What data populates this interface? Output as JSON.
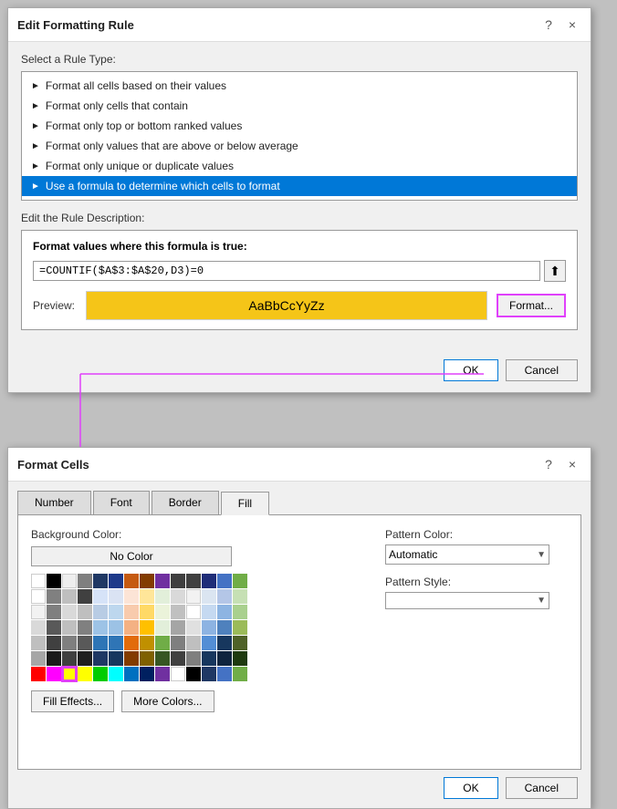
{
  "edit_dialog": {
    "title": "Edit Formatting Rule",
    "help_icon": "?",
    "close_icon": "×",
    "select_rule_label": "Select a Rule Type:",
    "rules": [
      {
        "label": "Format all cells based on their values",
        "selected": false
      },
      {
        "label": "Format only cells that contain",
        "selected": false
      },
      {
        "label": "Format only top or bottom ranked values",
        "selected": false
      },
      {
        "label": "Format only values that are above or below average",
        "selected": false
      },
      {
        "label": "Format only unique or duplicate values",
        "selected": false
      },
      {
        "label": "Use a formula to determine which cells to format",
        "selected": true
      }
    ],
    "desc_label": "Edit the Rule Description:",
    "desc_title": "Format values where this formula is true:",
    "formula_value": "=COUNTIF($A$3:$A$20,D3)=0",
    "preview_label": "Preview:",
    "preview_text": "AaBbCcYyZz",
    "format_btn_label": "Format...",
    "ok_label": "OK",
    "cancel_label": "Cancel"
  },
  "format_cells_dialog": {
    "title": "Format Cells",
    "help_icon": "?",
    "close_icon": "×",
    "tabs": [
      {
        "label": "Number",
        "active": false
      },
      {
        "label": "Font",
        "active": false
      },
      {
        "label": "Border",
        "active": false
      },
      {
        "label": "Fill",
        "active": true
      }
    ],
    "bg_color_label": "Background Color:",
    "no_color_label": "No Color",
    "pattern_color_label": "Pattern Color:",
    "pattern_color_value": "Automatic",
    "pattern_style_label": "Pattern Style:",
    "pattern_style_value": "",
    "fill_effects_label": "Fill Effects...",
    "more_colors_label": "More Colors...",
    "ok_label": "OK",
    "cancel_label": "Cancel"
  },
  "colors": {
    "row1": [
      "#ffffff",
      "#000000",
      "#eeeeee",
      "#7f7f7f",
      "#1f3864",
      "#1f3889",
      "#c55a11",
      "#833c00",
      "#7030a0",
      "#3f3f3f",
      "#404040",
      "#1f2d78",
      "#4472c4",
      "#70ad47"
    ],
    "row2": [
      "#ffffff",
      "#808080",
      "#bfbfbf",
      "#404040",
      "#d6e3f8",
      "#dae3f3",
      "#fce4d6",
      "#ffe699",
      "#e2efda",
      "#d9d9d9",
      "#f2f2f2",
      "#dbe5f1",
      "#b4c6e7",
      "#c6e0b4"
    ],
    "row3": [
      "#f2f2f2",
      "#7f7f7f",
      "#d9d9d9",
      "#bfbfbf",
      "#b8cce4",
      "#bdd7ee",
      "#f8cbad",
      "#ffd966",
      "#ebf3da",
      "#c0c0c0",
      "#ffffff",
      "#c5d9f1",
      "#8db4e2",
      "#a9d08e"
    ],
    "row4": [
      "#d9d9d9",
      "#595959",
      "#bfbfbf",
      "#808080",
      "#9dc3e6",
      "#9cc2e5",
      "#f4b183",
      "#ffc000",
      "#e2efda",
      "#a5a5a5",
      "#e0e0e0",
      "#8db3e2",
      "#4f81bd",
      "#9bbb59"
    ],
    "row5": [
      "#bfbfbf",
      "#404040",
      "#7f7f7f",
      "#595959",
      "#2e75b6",
      "#2f75b6",
      "#e26b0a",
      "#c09000",
      "#70ad47",
      "#7f7f7f",
      "#bfbfbf",
      "#538ed5",
      "#17375e",
      "#4f6228"
    ],
    "row6": [
      "#a6a6a6",
      "#1a1a1a",
      "#404040",
      "#1f1f1f",
      "#1f3864",
      "#17375e",
      "#833c00",
      "#7f6000",
      "#375623",
      "#404040",
      "#7f7f7f",
      "#17375e",
      "#0f243e",
      "#1e3a0f"
    ],
    "accent_row": [
      "#ff0000",
      "#ff00ff",
      "#ffff00",
      "#ffff00",
      "#00ff00",
      "#00ffff",
      "#0070c0",
      "#002060",
      "#7030a0",
      "#ffffff",
      "#000000",
      "#1f3864",
      "#4472c4",
      "#70ad47"
    ],
    "selected_color_index": {
      "row": 6,
      "col": 3
    }
  }
}
